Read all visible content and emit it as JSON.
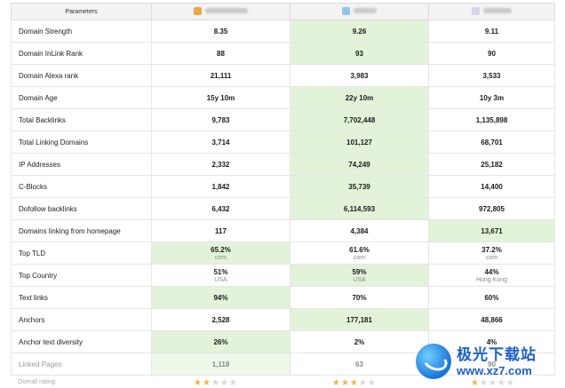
{
  "header": {
    "parameters_label": "Parameters",
    "sites": [
      {
        "favicon_color": "#e8a94a"
      },
      {
        "favicon_color": "#8ec7ea"
      },
      {
        "favicon_color": "#d6d6e8"
      }
    ]
  },
  "colors": {
    "highlight": "#e2f3d9",
    "border": "#e6e6e6",
    "header_bg": "#f3f3f3",
    "star_on": "#f0b24a",
    "star_off": "#d8d8d8"
  },
  "rows": [
    {
      "label": "Domain Strength",
      "values": [
        "8.35",
        "9.26",
        "9.11"
      ],
      "sub": [
        "",
        "",
        ""
      ],
      "highlight": 1
    },
    {
      "label": "Domain InLink Rank",
      "values": [
        "88",
        "93",
        "90"
      ],
      "sub": [
        "",
        "",
        ""
      ],
      "highlight": 1
    },
    {
      "label": "Domain Alexa rank",
      "values": [
        "21,111",
        "3,983",
        "3,533"
      ],
      "sub": [
        "",
        "",
        ""
      ],
      "highlight": -1
    },
    {
      "label": "Domain Age",
      "values": [
        "15y 10m",
        "22y 10m",
        "10y 3m"
      ],
      "sub": [
        "",
        "",
        ""
      ],
      "highlight": 1
    },
    {
      "label": "Total Backlinks",
      "values": [
        "9,783",
        "7,702,448",
        "1,135,898"
      ],
      "sub": [
        "",
        "",
        ""
      ],
      "highlight": 1
    },
    {
      "label": "Total Linking Domains",
      "values": [
        "3,714",
        "101,127",
        "68,701"
      ],
      "sub": [
        "",
        "",
        ""
      ],
      "highlight": 1
    },
    {
      "label": "IP Addresses",
      "values": [
        "2,332",
        "74,249",
        "25,182"
      ],
      "sub": [
        "",
        "",
        ""
      ],
      "highlight": 1
    },
    {
      "label": "C-Blocks",
      "values": [
        "1,842",
        "35,739",
        "14,400"
      ],
      "sub": [
        "",
        "",
        ""
      ],
      "highlight": 1
    },
    {
      "label": "Dofollow backlinks",
      "values": [
        "6,432",
        "6,114,593",
        "972,805"
      ],
      "sub": [
        "",
        "",
        ""
      ],
      "highlight": 1
    },
    {
      "label": "Domains linking from homepage",
      "values": [
        "117",
        "4,384",
        "13,671"
      ],
      "sub": [
        "",
        "",
        ""
      ],
      "highlight": 2
    },
    {
      "label": "Top TLD",
      "values": [
        "65.2%",
        "61.6%",
        "37.2%"
      ],
      "sub": [
        "com",
        "com",
        "com"
      ],
      "highlight": 0
    },
    {
      "label": "Top Country",
      "values": [
        "51%",
        "59%",
        "44%"
      ],
      "sub": [
        "USA",
        "USA",
        "Hong Kong"
      ],
      "highlight": 1
    },
    {
      "label": "Text links",
      "values": [
        "94%",
        "70%",
        "60%"
      ],
      "sub": [
        "",
        "",
        ""
      ],
      "highlight": 0
    },
    {
      "label": "Anchors",
      "values": [
        "2,528",
        "177,181",
        "48,866"
      ],
      "sub": [
        "",
        "",
        ""
      ],
      "highlight": 1
    },
    {
      "label": "Anchor text diversity",
      "values": [
        "26%",
        "2%",
        "4%"
      ],
      "sub": [
        "",
        "",
        ""
      ],
      "highlight": 0
    },
    {
      "label": "Linked Pages",
      "values": [
        "1,118",
        "63",
        "90"
      ],
      "sub": [
        "",
        "",
        ""
      ],
      "highlight": 0,
      "faded": true
    }
  ],
  "rating": {
    "label": "Overall rating:",
    "stars": [
      2,
      3,
      1
    ],
    "max": 5
  },
  "watermark": {
    "brand": "极光下载站",
    "url": "www.xz7.com"
  }
}
